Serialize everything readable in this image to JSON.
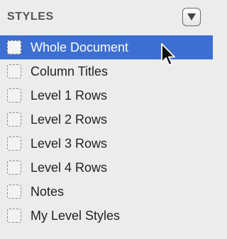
{
  "panel": {
    "title": "STYLES",
    "menu_icon": "triangle-down-icon"
  },
  "styles": [
    {
      "label": "Whole Document",
      "selected": true
    },
    {
      "label": "Column Titles",
      "selected": false
    },
    {
      "label": "Level 1 Rows",
      "selected": false
    },
    {
      "label": "Level 2 Rows",
      "selected": false
    },
    {
      "label": "Level 3 Rows",
      "selected": false
    },
    {
      "label": "Level 4 Rows",
      "selected": false
    },
    {
      "label": "Notes",
      "selected": false
    },
    {
      "label": "My Level Styles",
      "selected": false
    }
  ],
  "colors": {
    "selection": "#3d6fd3",
    "background": "#ececec",
    "title_text": "#555555"
  }
}
